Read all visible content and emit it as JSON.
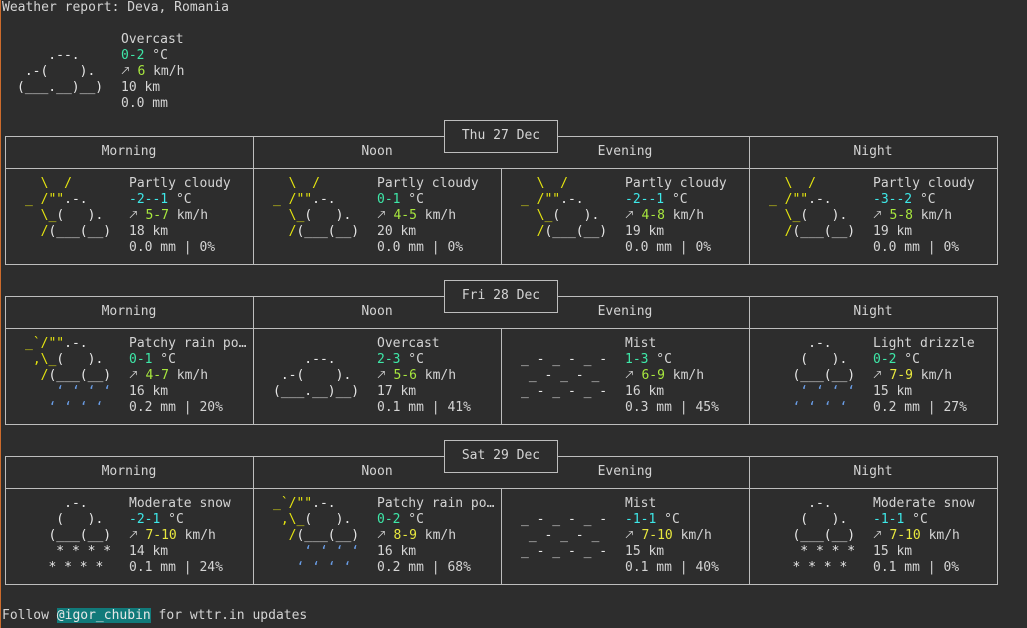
{
  "header": {
    "title": "Weather report: Deva, Romania"
  },
  "current": {
    "condition": "Overcast",
    "temp": "0-2",
    "temp_unit": " °C",
    "wind_arrow": "🡕",
    "wind": "6",
    "wind_unit": " km/h",
    "visibility": "10 km",
    "precip": "0.0 mm",
    "temp_color": "#3ee8a8",
    "wind_color": "#a8e83e"
  },
  "period_labels": [
    "Morning",
    "Noon",
    "Evening",
    "Night"
  ],
  "days": [
    {
      "date": "Thu 27 Dec",
      "periods": [
        {
          "icon": "partly-cloudy-icon",
          "condition": "Partly cloudy",
          "temp": "-2--1",
          "temp_color": "#3ee8e8",
          "wind_arrow": "🡕",
          "wind": "5-7",
          "wind_color": "#a8e83e",
          "visibility": "18 km",
          "precip": "0.0 mm | 0%"
        },
        {
          "icon": "partly-cloudy-icon",
          "condition": "Partly cloudy",
          "temp": "0-1",
          "temp_color": "#3ee8a8",
          "wind_arrow": "🡕",
          "wind": "4-5",
          "wind_color": "#a8e83e",
          "visibility": "20 km",
          "precip": "0.0 mm | 0%"
        },
        {
          "icon": "partly-cloudy-icon",
          "condition": "Partly cloudy",
          "temp": "-2--1",
          "temp_color": "#3ee8e8",
          "wind_arrow": "🡕",
          "wind": "4-8",
          "wind_color": "#a8e83e",
          "visibility": "19 km",
          "precip": "0.0 mm | 0%"
        },
        {
          "icon": "partly-cloudy-icon",
          "condition": "Partly cloudy",
          "temp": "-3--2",
          "temp_color": "#3ee8e8",
          "wind_arrow": "🡕",
          "wind": "5-8",
          "wind_color": "#a8e83e",
          "visibility": "19 km",
          "precip": "0.0 mm | 0%"
        }
      ]
    },
    {
      "date": "Fri 28 Dec",
      "periods": [
        {
          "icon": "patchy-rain-icon",
          "condition": "Patchy rain po…",
          "temp": "0-1",
          "temp_color": "#3ee8a8",
          "wind_arrow": "🡕",
          "wind": "4-7",
          "wind_color": "#a8e83e",
          "visibility": "16 km",
          "precip": "0.2 mm | 20%"
        },
        {
          "icon": "overcast-icon",
          "condition": "Overcast",
          "temp": "2-3",
          "temp_color": "#3ee8a8",
          "wind_arrow": "🡕",
          "wind": "5-6",
          "wind_color": "#a8e83e",
          "visibility": "17 km",
          "precip": "0.1 mm | 41%"
        },
        {
          "icon": "mist-icon",
          "condition": "Mist",
          "temp": "1-3",
          "temp_color": "#3ee8a8",
          "wind_arrow": "🡕",
          "wind": "6-9",
          "wind_color": "#a8e83e",
          "visibility": "16 km",
          "precip": "0.3 mm | 45%"
        },
        {
          "icon": "light-drizzle-icon",
          "condition": "Light drizzle",
          "temp": "0-2",
          "temp_color": "#3ee8a8",
          "wind_arrow": "🡕",
          "wind": "7-9",
          "wind_color": "#e8e83e",
          "visibility": "15 km",
          "precip": "0.2 mm | 27%"
        }
      ]
    },
    {
      "date": "Sat 29 Dec",
      "periods": [
        {
          "icon": "moderate-snow-icon",
          "condition": "Moderate snow",
          "temp": "-2-1",
          "temp_color": "#3ee8e8",
          "wind_arrow": "🡕",
          "wind": "7-10",
          "wind_color": "#e8e83e",
          "visibility": "14 km",
          "precip": "0.1 mm | 24%"
        },
        {
          "icon": "patchy-rain-icon",
          "condition": "Patchy rain po…",
          "temp": "0-2",
          "temp_color": "#3ee8a8",
          "wind_arrow": "🡕",
          "wind": "8-9",
          "wind_color": "#e8e83e",
          "visibility": "16 km",
          "precip": "0.2 mm | 68%"
        },
        {
          "icon": "mist-icon",
          "condition": "Mist",
          "temp": "-1-1",
          "temp_color": "#3ee8e8",
          "wind_arrow": "🡕",
          "wind": "7-10",
          "wind_color": "#e8e83e",
          "visibility": "15 km",
          "precip": "0.1 mm | 40%"
        },
        {
          "icon": "moderate-snow-icon",
          "condition": "Moderate snow",
          "temp": "-1-1",
          "temp_color": "#3ee8e8",
          "wind_arrow": "🡕",
          "wind": "7-10",
          "wind_color": "#e8e83e",
          "visibility": "15 km",
          "precip": "0.1 mm | 0%"
        }
      ]
    }
  ],
  "footer": {
    "prefix": "Follow ",
    "handle": "@igor_chubin",
    "suffix": " for wttr.in updates"
  }
}
